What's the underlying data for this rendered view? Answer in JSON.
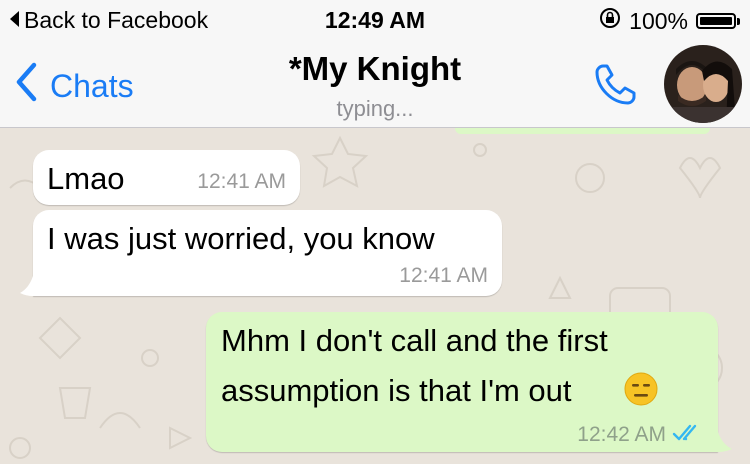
{
  "status_bar": {
    "back_label": "Back to Facebook",
    "time": "12:49 AM",
    "battery": "100%",
    "battery_level": 1.0,
    "icons": [
      "back-arrow-icon",
      "orientation-lock-icon",
      "battery-icon"
    ]
  },
  "nav": {
    "back_label": "Chats",
    "title": "*My Knight",
    "subtitle": "typing...",
    "icons": [
      "chevron-left-icon",
      "phone-icon",
      "avatar"
    ]
  },
  "messages": [
    {
      "direction": "incoming",
      "text": "Lmao",
      "time": "12:41 AM"
    },
    {
      "direction": "incoming",
      "text": "I was just worried, you know",
      "time": "12:41 AM"
    },
    {
      "direction": "outgoing",
      "lines": [
        "Mhm I don't call and the first",
        "assumption is that I'm out"
      ],
      "emoji": "expressionless-face-emoji",
      "time": "12:42 AM",
      "status_icon": "double-check-read-icon"
    }
  ],
  "colors": {
    "accent": "#1a7cf5",
    "incoming_bubble": "#ffffff",
    "outgoing_bubble": "#dcf8c6",
    "chat_background": "#e9e3db",
    "read_ticks": "#34b7f1",
    "emoji": "#f7c325"
  }
}
